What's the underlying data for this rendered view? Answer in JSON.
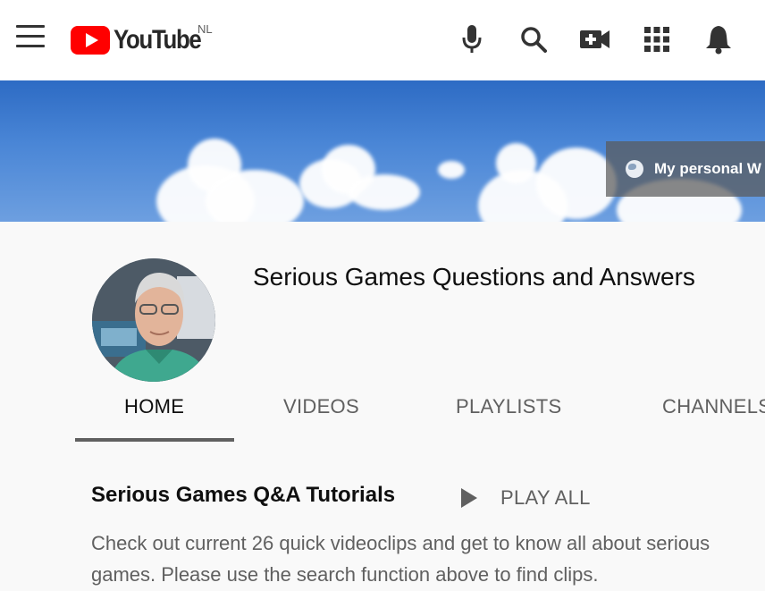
{
  "header": {
    "logo_text": "YouTube",
    "region": "NL",
    "icons": [
      "menu-icon",
      "microphone-icon",
      "search-icon",
      "create-video-icon",
      "apps-grid-icon",
      "notifications-bell-icon"
    ]
  },
  "banner": {
    "link_text": "My personal W"
  },
  "channel": {
    "name": "Serious Games Questions and Answers"
  },
  "tabs": [
    {
      "label": "HOME",
      "active": true
    },
    {
      "label": "VIDEOS",
      "active": false
    },
    {
      "label": "PLAYLISTS",
      "active": false
    },
    {
      "label": "CHANNELS",
      "active": false
    }
  ],
  "shelf": {
    "title": "Serious Games Q&A Tutorials",
    "play_all_label": "PLAY ALL",
    "description": "Check out current 26 quick videoclips and get to know all about serious games. Please use the search function above to find clips."
  },
  "colors": {
    "brand_red": "#ff0000",
    "text_primary": "#0f0f0f",
    "text_secondary": "#606060",
    "background": "#f9f9f9"
  }
}
